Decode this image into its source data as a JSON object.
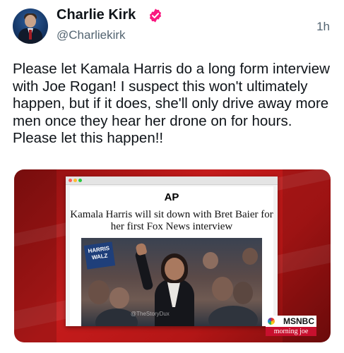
{
  "tweet": {
    "author_name": "Charlie Kirk",
    "handle": "@Charliekirk",
    "timestamp": "1h",
    "text": "Please let Kamala Harris do a long form interview with Joe Rogan! I suspect this won't ultimately happen, but if it does, she'll only drive away more men once they hear her drone on for hours. Please let this happen!!"
  },
  "media": {
    "publisher_logo": "AP",
    "headline": "Kamala Harris will sit down with Bret Baier for her first Fox News interview",
    "photo_sign_text": "HARRIS WALZ",
    "photo_watermark": "@TheStoryDux",
    "network_logo": "MSNBC",
    "network_show": "morning joe"
  },
  "colors": {
    "badge": "#f91880",
    "secondary_text": "#536471",
    "frame_red": "#c41b1b"
  },
  "icons": [
    "verified-badge-icon",
    "peacock-icon"
  ]
}
